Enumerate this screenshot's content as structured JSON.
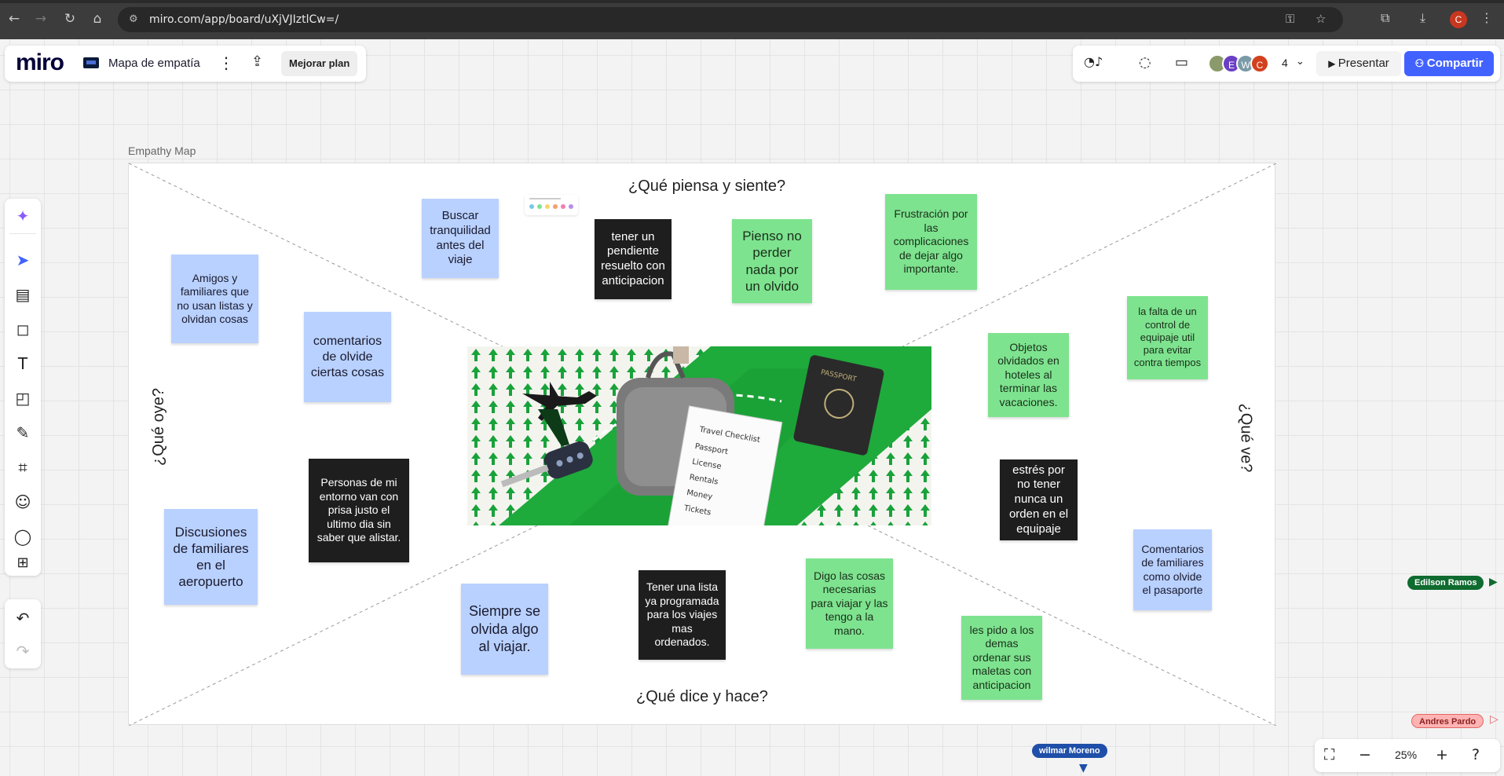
{
  "browser": {
    "url": "miro.com/app/board/uXjVJIztlCw=/"
  },
  "board": {
    "logo": "miro",
    "name": "Mapa de empatía",
    "upgrade_label": "Mejorar plan"
  },
  "collab": {
    "avatars": [
      {
        "initial": "",
        "color": "#8a9a6a"
      },
      {
        "initial": "E",
        "color": "#6a3fc4"
      },
      {
        "initial": "W",
        "color": "#7a9aa8"
      },
      {
        "initial": "C",
        "color": "#d2401e"
      }
    ],
    "count": "4",
    "present_label": "Presentar",
    "share_label": "Compartir"
  },
  "frame": {
    "label": "Empathy Map",
    "quadrants": {
      "top": "¿Qué piensa y siente?",
      "bottom": "¿Qué dice y hace?",
      "left": "¿Qué oye?",
      "right": "¿Qué ve?"
    }
  },
  "notes": [
    {
      "text": "Buscar tranquilidad antes del viaje",
      "color": "blue"
    },
    {
      "text": "tener un pendiente resuelto con anticipacion",
      "color": "black"
    },
    {
      "text": "Pienso no perder nada por un olvido",
      "color": "green"
    },
    {
      "text": "Frustración por las complicaciones de dejar algo importante.",
      "color": "green"
    },
    {
      "text": "Amigos y familiares que no usan listas y olvidan cosas",
      "color": "blue"
    },
    {
      "text": "comentarios de olvide ciertas cosas",
      "color": "blue"
    },
    {
      "text": "Personas de mi entorno van con prisa justo el ultimo dia sin saber que alistar.",
      "color": "black"
    },
    {
      "text": "Discusiones de familiares en el aeropuerto",
      "color": "blue"
    },
    {
      "text": "Objetos olvidados en hoteles al terminar las vacaciones.",
      "color": "green"
    },
    {
      "text": "la falta de un control de equipaje util para evitar contra tiempos",
      "color": "green"
    },
    {
      "text": "estrés por no tener nunca un orden en el equipaje",
      "color": "black"
    },
    {
      "text": "Comentarios de familiares como olvide el pasaporte",
      "color": "blue"
    },
    {
      "text": "Siempre se olvida algo al viajar.",
      "color": "blue"
    },
    {
      "text": "Tener una lista ya programada para los viajes mas ordenados.",
      "color": "black"
    },
    {
      "text": "Digo las cosas necesarias para viajar y las tengo a la mano.",
      "color": "green"
    },
    {
      "text": "les pido a los demas ordenar sus maletas con anticipacion",
      "color": "green"
    }
  ],
  "hero": {
    "checklist_title": "Travel Checklist",
    "checklist_items": [
      "Passport",
      "License",
      "Rentals",
      "Money",
      "Tickets"
    ],
    "passport_label": "PASSPORT"
  },
  "cursors": [
    {
      "name": "Edilson Ramos",
      "bg": "#0f6b2f",
      "fg": "#ffffff"
    },
    {
      "name": "Andres Pardo",
      "bg": "#ffb3b3",
      "fg": "#8a1f1f"
    },
    {
      "name": "wilmar Moreno",
      "bg": "#1f4fa8",
      "fg": "#ffffff"
    }
  ],
  "zoom": {
    "level": "25%"
  },
  "icons": {
    "back": "back-arrow-icon",
    "forward": "forward-arrow-icon",
    "reload": "reload-icon",
    "home": "home-icon",
    "ai": "sparkle-icon",
    "select": "cursor-icon",
    "templates": "layout-icon",
    "sticky": "sticky-note-icon",
    "text": "text-icon",
    "shapes": "shapes-icon",
    "pen": "pen-icon",
    "frame": "frame-icon",
    "reactions": "emoji-icon",
    "comment": "comment-icon",
    "more": "plus-icon",
    "undo": "undo-icon",
    "redo": "redo-icon"
  }
}
